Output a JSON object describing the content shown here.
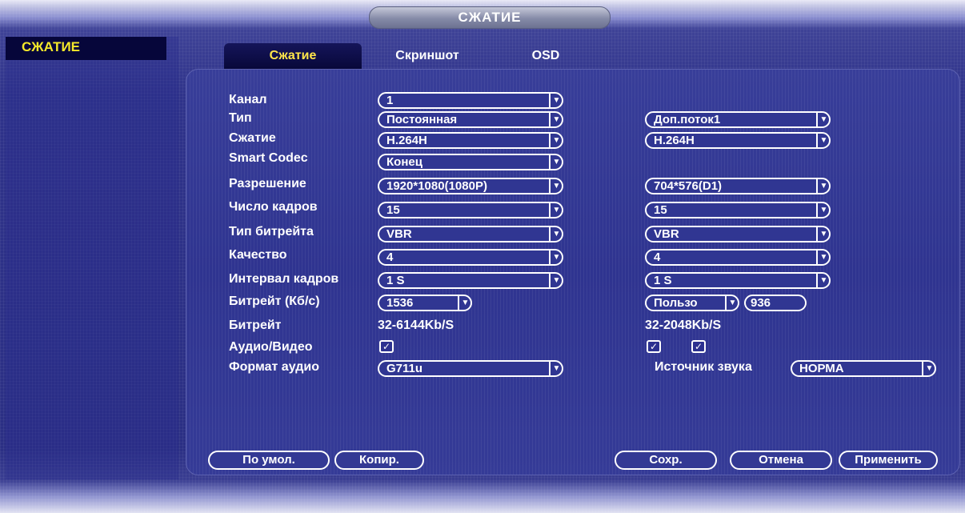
{
  "window": {
    "title": "СЖАТИЕ"
  },
  "sidebar": {
    "active_item": "СЖАТИЕ"
  },
  "tabs": [
    {
      "label": "Сжатие",
      "active": true
    },
    {
      "label": "Скриншот",
      "active": false
    },
    {
      "label": "OSD",
      "active": false
    }
  ],
  "form": {
    "labels": {
      "channel": "Канал",
      "type": "Тип",
      "compression": "Сжатие",
      "smart_codec": "Smart Codec",
      "resolution": "Разрешение",
      "frame_rate": "Число кадров",
      "bitrate_type": "Тип битрейта",
      "quality": "Качество",
      "frame_interval": "Интервал кадров",
      "bitrate_kbs": "Битрейт (Кб/с)",
      "bitrate": "Битрейт",
      "audio_video": "Аудио/Видео",
      "audio_format": "Формат аудио",
      "audio_source": "Источник звука"
    },
    "main": {
      "channel": "1",
      "type": "Постоянная",
      "compression": "H.264H",
      "smart_codec": "Конец",
      "resolution": "1920*1080(1080P)",
      "frame_rate": "15",
      "bitrate_type": "VBR",
      "quality": "4",
      "frame_interval": "1 S",
      "bitrate_kbs": "1536",
      "bitrate_range": "32-6144Kb/S",
      "audio_video_checked": true,
      "audio_format": "G711u"
    },
    "sub": {
      "type": "Доп.поток1",
      "compression": "H.264H",
      "resolution": "704*576(D1)",
      "frame_rate": "15",
      "bitrate_type": "VBR",
      "quality": "4",
      "frame_interval": "1 S",
      "bitrate_mode": "Пользо",
      "bitrate_kbs": "936",
      "bitrate_range": "32-2048Kb/S",
      "audio_video_checked": [
        true,
        true
      ],
      "audio_source": "НОРМА"
    }
  },
  "buttons": {
    "default": "По умол.",
    "copy": "Копир.",
    "save": "Сохр.",
    "cancel": "Отмена",
    "apply": "Применить"
  },
  "colors": {
    "background": "#2f338a",
    "active_tab_text": "#ffe64a",
    "sidebar_active_text": "#f4e82a"
  }
}
